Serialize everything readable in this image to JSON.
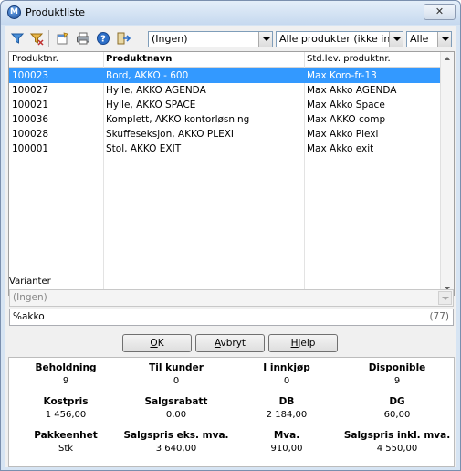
{
  "window": {
    "title": "Produktliste",
    "close_glyph": "✕"
  },
  "toolbar": {
    "icons": [
      "filter-icon",
      "filter-clear-icon",
      "edit-product-icon",
      "print-icon",
      "help-icon",
      "exit-icon"
    ],
    "combo1": "(Ingen)",
    "combo2": "Alle produkter (ikke inakt",
    "combo3": "Alle"
  },
  "list": {
    "columns": [
      "Produktnr.",
      "Produktnavn",
      "Std.lev. produktnr."
    ],
    "rows": [
      {
        "nr": "100023",
        "navn": "Bord, AKKO - 600",
        "lev": "Max Koro-fr-13",
        "selected": true
      },
      {
        "nr": "100027",
        "navn": "Hylle, AKKO AGENDA",
        "lev": "Max Akko AGENDA",
        "selected": false
      },
      {
        "nr": "100021",
        "navn": "Hylle, AKKO SPACE",
        "lev": "Max Akko Space",
        "selected": false
      },
      {
        "nr": "100036",
        "navn": "Komplett, AKKO kontorløsning",
        "lev": "Max  AKKO comp",
        "selected": false
      },
      {
        "nr": "100028",
        "navn": "Skuffeseksjon, AKKO PLEXI",
        "lev": "Max Akko Plexi",
        "selected": false
      },
      {
        "nr": "100001",
        "navn": "Stol, AKKO EXIT",
        "lev": "Max Akko exit",
        "selected": false
      }
    ]
  },
  "varianter": {
    "label": "Varianter",
    "value": "(Ingen)"
  },
  "search": {
    "value": "%akko",
    "count": "(77)"
  },
  "buttons": {
    "ok": {
      "u": "O",
      "rest": "K"
    },
    "cancel": {
      "u": "A",
      "rest": "vbryt"
    },
    "help": {
      "u": "H",
      "rest": "jelp"
    }
  },
  "info": {
    "beholdning": {
      "label": "Beholdning",
      "value": "9"
    },
    "til_kunder": {
      "label": "Til kunder",
      "value": "0"
    },
    "i_innkjop": {
      "label": "I innkjøp",
      "value": "0"
    },
    "disponible": {
      "label": "Disponible",
      "value": "9"
    },
    "kostpris": {
      "label": "Kostpris",
      "value": "1 456,00"
    },
    "salgsrabatt": {
      "label": "Salgsrabatt",
      "value": "0,00"
    },
    "db": {
      "label": "DB",
      "value": "2 184,00"
    },
    "dg": {
      "label": "DG",
      "value": "60,00"
    },
    "pakkeenhet": {
      "label": "Pakkeenhet",
      "value": "Stk"
    },
    "salgspris_eks": {
      "label": "Salgspris eks. mva.",
      "value": "3 640,00"
    },
    "mva": {
      "label": "Mva.",
      "value": "910,00"
    },
    "salgspris_inkl": {
      "label": "Salgspris inkl. mva.",
      "value": "4 550,00"
    }
  },
  "colors": {
    "selection": "#3399ff",
    "title_gradient_top": "#e4eef9",
    "title_gradient_bottom": "#c6d9ef"
  }
}
